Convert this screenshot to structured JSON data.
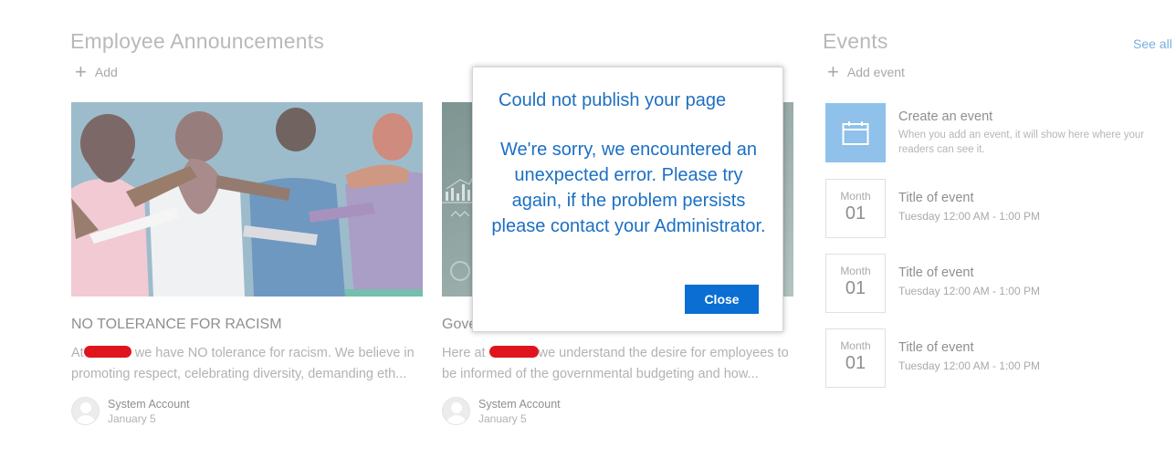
{
  "announcements": {
    "title": "Employee Announcements",
    "add_label": "Add",
    "cards": [
      {
        "title": "NO TOLERANCE FOR RACISM",
        "desc_prefix": "At",
        "desc_rest": " we have NO tolerance for racism. We believe in promoting respect, celebrating diversity, demanding eth...",
        "author": "System Account",
        "date": "January 5"
      },
      {
        "title": "Gove",
        "desc_prefix": "Here at",
        "desc_rest": "we understand the desire for employees to be informed of the governmental budgeting and how...",
        "author": "System Account",
        "date": "January 5"
      }
    ]
  },
  "events": {
    "title": "Events",
    "see_all": "See all",
    "add_label": "Add event",
    "create": {
      "title": "Create an event",
      "desc": "When you add an event, it will show here where your readers can see it."
    },
    "items": [
      {
        "month": "Month",
        "day": "01",
        "title": "Title of event",
        "time": "Tuesday 12:00 AM - 1:00 PM"
      },
      {
        "month": "Month",
        "day": "01",
        "title": "Title of event",
        "time": "Tuesday 12:00 AM - 1:00 PM"
      },
      {
        "month": "Month",
        "day": "01",
        "title": "Title of event",
        "time": "Tuesday 12:00 AM - 1:00 PM"
      }
    ]
  },
  "dialog": {
    "title": "Could not publish your page",
    "message": "We're sorry, we encountered an unexpected error. Please try again, if the problem persists please contact your Administrator.",
    "close_label": "Close"
  },
  "colors": {
    "accent": "#0a6ed3",
    "dialog_text": "#1b6fc3",
    "redaction": "#e0141d",
    "calendar_tile": "#8fc1ea"
  }
}
